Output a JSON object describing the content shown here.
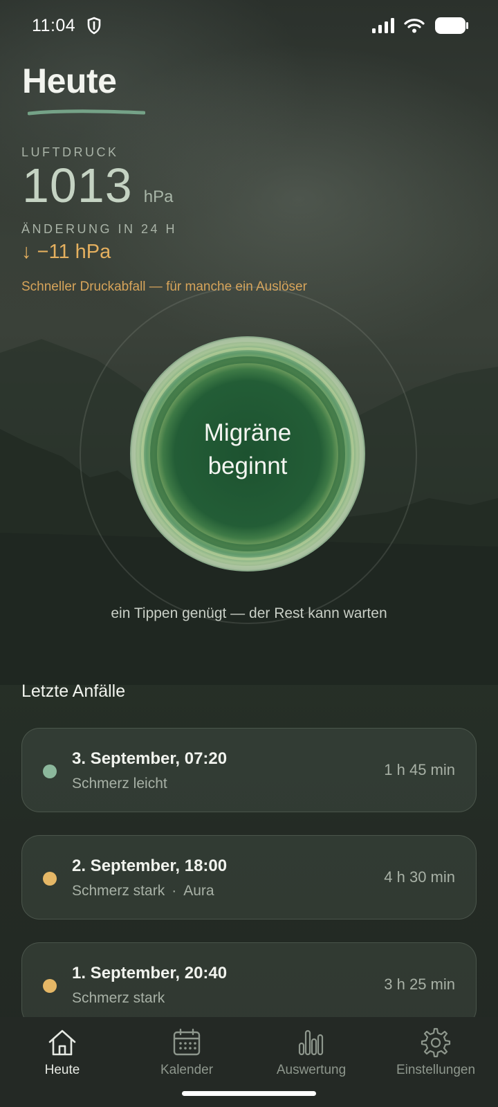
{
  "status": {
    "time": "11:04"
  },
  "header": {
    "title": "Heute"
  },
  "pressure": {
    "label": "LUFTDRUCK",
    "value": "1013",
    "unit": "hPa",
    "change_label": "ÄNDERUNG IN 24 H",
    "change_value": "↓ −11 hPa",
    "warning": "Schneller Druckabfall — für manche ein Auslöser"
  },
  "main_button": {
    "line1": "Migräne",
    "line2": "beginnt"
  },
  "hint": "ein Tippen genügt — der Rest kann warten",
  "recent": {
    "title": "Letzte Anfälle",
    "items": [
      {
        "date": "3. September, 07:20",
        "pain": "Schmerz leicht",
        "aura": "",
        "duration": "1 h 45 min",
        "dot_color": "#8cb89c"
      },
      {
        "date": "2. September, 18:00",
        "pain": "Schmerz stark",
        "aura": "Aura",
        "duration": "4 h 30 min",
        "dot_color": "#e5b766"
      },
      {
        "date": "1. September, 20:40",
        "pain": "Schmerz stark",
        "aura": "",
        "duration": "3 h 25 min",
        "dot_color": "#e5b766"
      }
    ]
  },
  "tabs": [
    {
      "label": "Heute",
      "icon": "home-icon",
      "active": true
    },
    {
      "label": "Kalender",
      "icon": "calendar-icon",
      "active": false
    },
    {
      "label": "Auswertung",
      "icon": "bar-chart-icon",
      "active": false
    },
    {
      "label": "Einstellungen",
      "icon": "gear-icon",
      "active": false
    }
  ],
  "colors": {
    "accent_warning": "#e5b05f",
    "button_green": "#1f5a34"
  }
}
